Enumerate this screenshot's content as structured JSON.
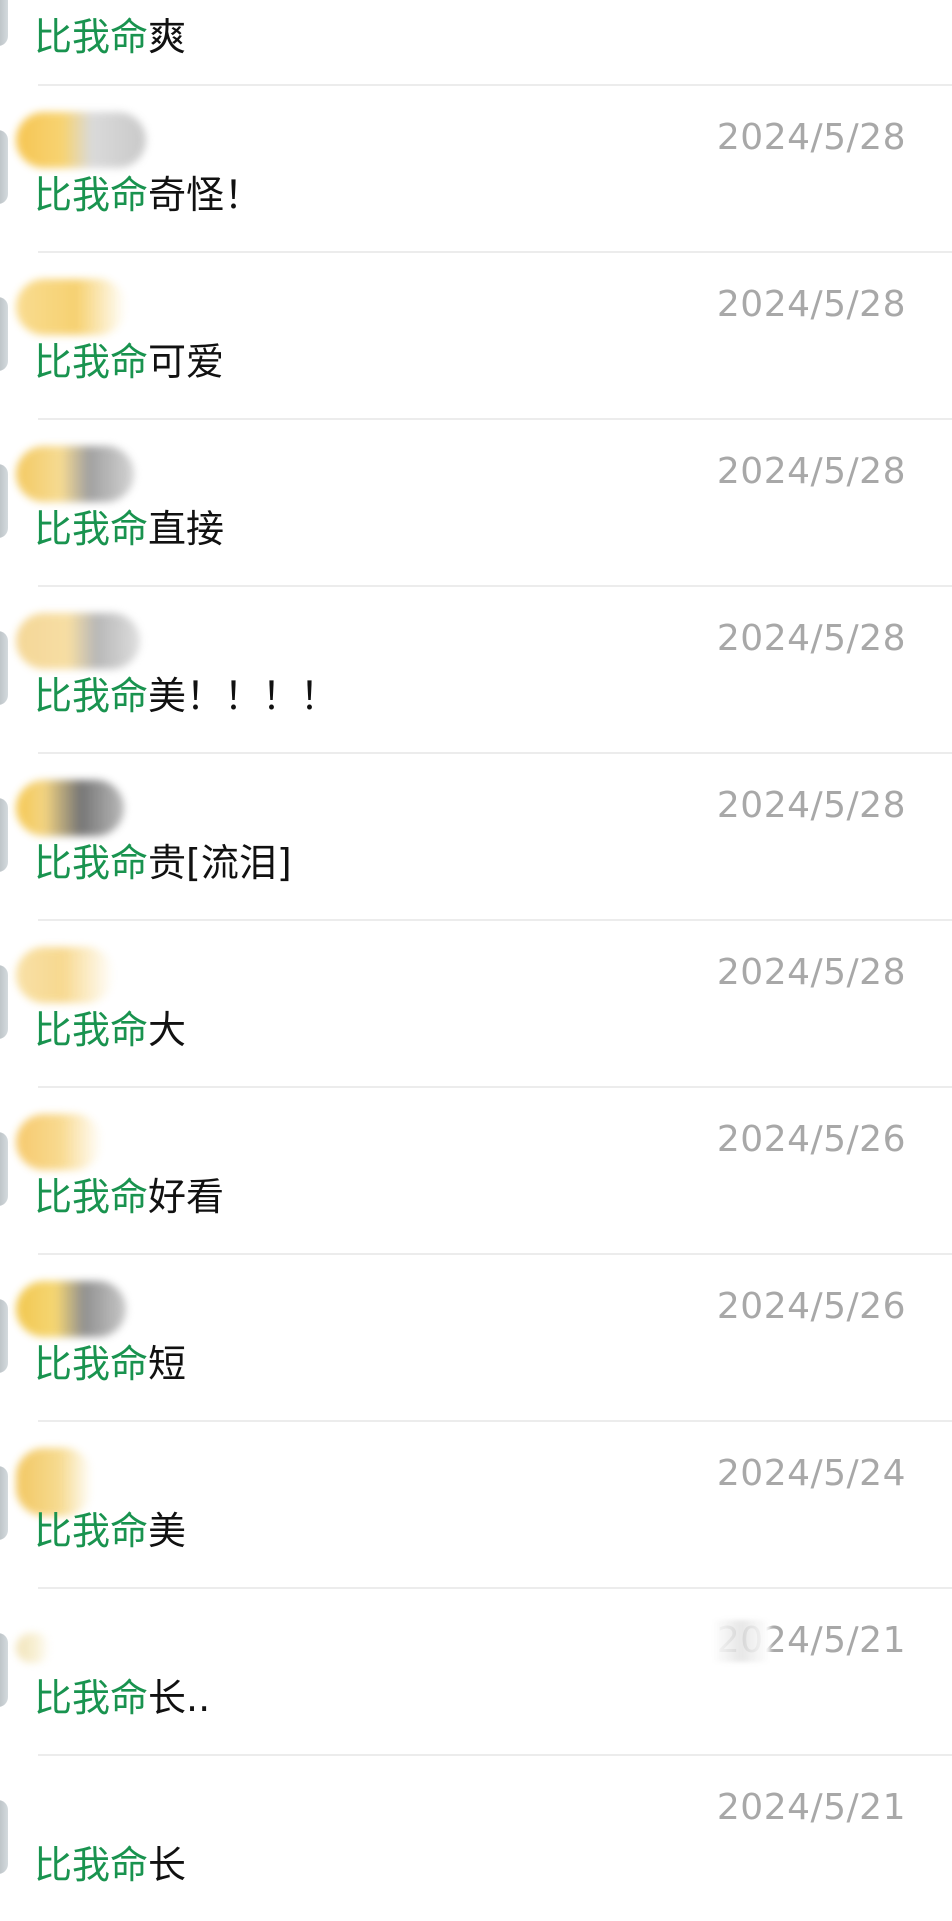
{
  "comments": [
    {
      "mention": "比我命",
      "text": "爽",
      "date": ""
    },
    {
      "mention": "比我命",
      "text": "奇怪！",
      "date": "2024/5/28"
    },
    {
      "mention": "比我命",
      "text": "可爱",
      "date": "2024/5/28"
    },
    {
      "mention": "比我命",
      "text": "直接",
      "date": "2024/5/28"
    },
    {
      "mention": "比我命",
      "text": "美！！！！",
      "date": "2024/5/28"
    },
    {
      "mention": "比我命",
      "text": "贵[流泪]",
      "date": "2024/5/28"
    },
    {
      "mention": "比我命",
      "text": "大",
      "date": "2024/5/28"
    },
    {
      "mention": "比我命",
      "text": "好看",
      "date": "2024/5/26"
    },
    {
      "mention": "比我命",
      "text": "短",
      "date": "2024/5/26"
    },
    {
      "mention": "比我命",
      "text": "美",
      "date": "2024/5/24"
    },
    {
      "mention": "比我命",
      "text": "长..",
      "date": "2024/5/21"
    },
    {
      "mention": "比我命",
      "text": "长",
      "date": "2024/5/21"
    }
  ]
}
